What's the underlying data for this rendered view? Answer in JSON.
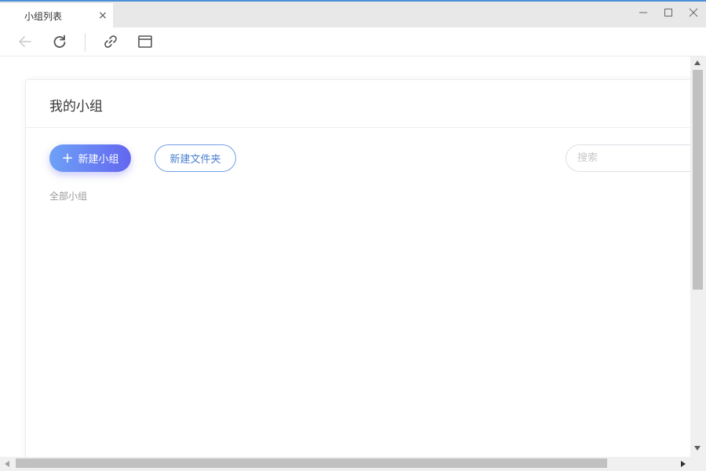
{
  "tab": {
    "label": "小组列表",
    "close": "×"
  },
  "window_controls": {
    "minimize": "minimize-icon",
    "maximize": "maximize-icon",
    "close": "close-icon"
  },
  "toolbar": {
    "back": "back-arrow-icon",
    "refresh": "refresh-icon",
    "link": "link-icon",
    "window": "window-icon"
  },
  "card": {
    "title": "我的小组",
    "new_group_label": "新建小组",
    "new_group_plus": "+",
    "new_folder_label": "新建文件夹",
    "search_placeholder": "搜索",
    "search_value": "",
    "all_groups_label": "全部小组"
  },
  "colors": {
    "accent_start": "#6ea1f6",
    "accent_end": "#6366f0",
    "outline_button": "#6f9ee6"
  }
}
